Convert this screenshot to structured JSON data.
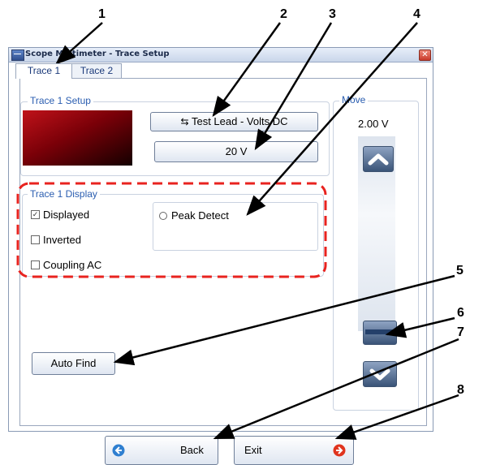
{
  "window": {
    "title": "Scope Multimeter - Trace Setup",
    "close_glyph": "✕"
  },
  "tabs": [
    {
      "label": "Trace 1",
      "selected": true
    },
    {
      "label": "Trace 2",
      "selected": false
    }
  ],
  "setup": {
    "group_label": "Trace 1 Setup",
    "trace_color": "#c0121a",
    "lead_button_label": "Test Lead - Volts DC",
    "lead_icon": "lead-icon",
    "scale_button_label": "20 V"
  },
  "display": {
    "group_label": "Trace 1 Display",
    "displayed": {
      "label": "Displayed",
      "checked": true
    },
    "inverted": {
      "label": "Inverted",
      "checked": false
    },
    "coupling_ac": {
      "label": "Coupling AC",
      "checked": false
    },
    "peak_detect": {
      "label": "Peak Detect",
      "selected": false
    }
  },
  "auto_find_label": "Auto Find",
  "move": {
    "group_label": "Move",
    "value": "2.00 V",
    "up_icon": "chevron-up-icon",
    "down_icon": "chevron-down-icon",
    "position_icon": "position-handle-icon"
  },
  "footer": {
    "back_label": "Back",
    "exit_label": "Exit"
  },
  "callouts": [
    "1",
    "2",
    "3",
    "4",
    "5",
    "6",
    "7",
    "8"
  ],
  "colors": {
    "highlight_dashed": "#e8231f",
    "group_label": "#2a5db0",
    "back_icon": "#2f7fd0",
    "exit_icon": "#e0341e"
  }
}
